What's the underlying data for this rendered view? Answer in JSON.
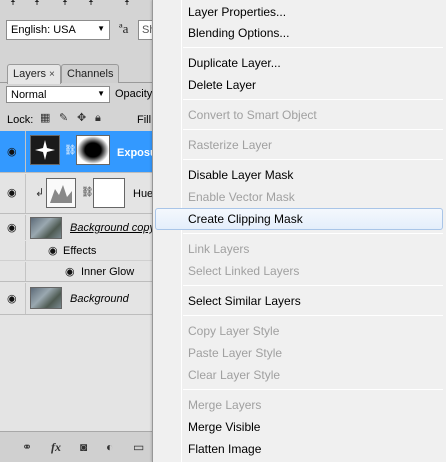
{
  "character_panel": {
    "language": "English: USA",
    "aa_glyph": "ªa",
    "sharpness_partial": "Sh"
  },
  "layers_panel": {
    "tabs": [
      {
        "label": "Layers",
        "close": "×"
      },
      {
        "label": "Channels"
      }
    ],
    "blend_mode": "Normal",
    "opacity_label": "Opacity:",
    "lock_label": "Lock:",
    "fill_label": "Fill:",
    "layers": [
      {
        "name": "Exposure",
        "selected": true
      },
      {
        "name": "Hue/Sat",
        "selected": false
      },
      {
        "name": "Background copy",
        "selected": false
      },
      {
        "name": "Effects",
        "selected": false
      },
      {
        "name": "Inner Glow",
        "selected": false
      },
      {
        "name": "Background",
        "selected": false
      }
    ],
    "bottom_icons": [
      "link-icon",
      "fx-icon",
      "mask-icon",
      "adjustment-icon",
      "folder-icon"
    ],
    "fx_label": "fx"
  },
  "context_menu": {
    "items": [
      {
        "label": "Layer Properties...",
        "enabled": true
      },
      {
        "label": "Blending Options...",
        "enabled": true
      },
      {
        "label": "Duplicate Layer...",
        "enabled": true
      },
      {
        "label": "Delete Layer",
        "enabled": true
      },
      {
        "label": "Convert to Smart Object",
        "enabled": false
      },
      {
        "label": "Rasterize Layer",
        "enabled": false
      },
      {
        "label": "Disable Layer Mask",
        "enabled": true
      },
      {
        "label": "Enable Vector Mask",
        "enabled": false
      },
      {
        "label": "Create Clipping Mask",
        "enabled": true,
        "hovered": true
      },
      {
        "label": "Link Layers",
        "enabled": false
      },
      {
        "label": "Select Linked Layers",
        "enabled": false
      },
      {
        "label": "Select Similar Layers",
        "enabled": true
      },
      {
        "label": "Copy Layer Style",
        "enabled": false
      },
      {
        "label": "Paste Layer Style",
        "enabled": false
      },
      {
        "label": "Clear Layer Style",
        "enabled": false
      },
      {
        "label": "Merge Layers",
        "enabled": false
      },
      {
        "label": "Merge Visible",
        "enabled": true
      },
      {
        "label": "Flatten Image",
        "enabled": true
      }
    ]
  },
  "colors": {
    "selection": "#3399ff",
    "menu_bg": "#f0f0f0",
    "disabled_text": "#a0a0a0",
    "hover_border": "#a9c5e8"
  }
}
